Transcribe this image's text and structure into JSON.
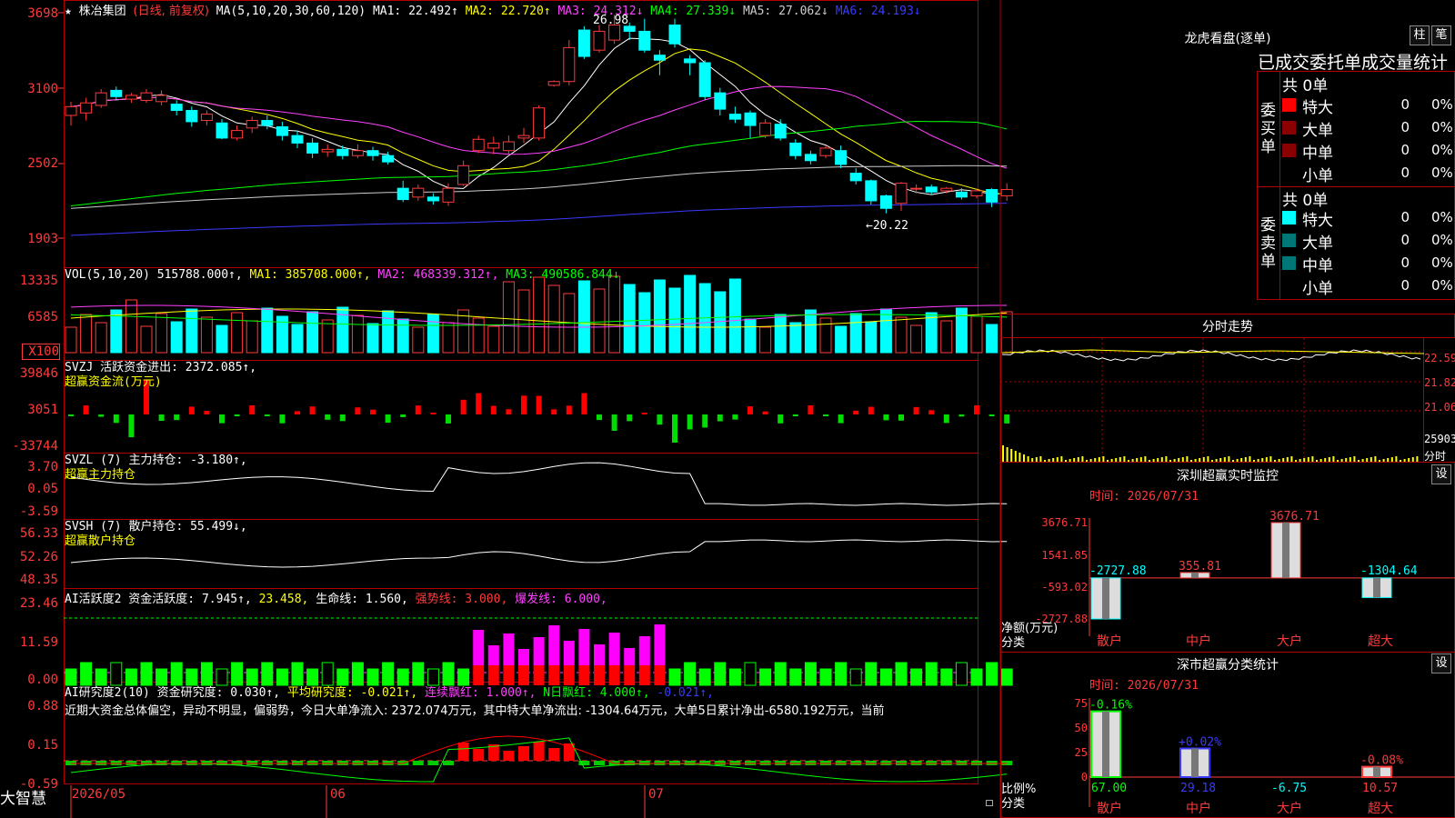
{
  "header": {
    "star": "★",
    "name": "株冶集团",
    "mode": "(日线, 前复权)",
    "ma_def": "MA(5,10,20,30,60,120)",
    "ma": [
      {
        "label": "MA1: 22.492↑",
        "color": "#ffffff"
      },
      {
        "label": "MA2: 22.720↑",
        "color": "#ffff00"
      },
      {
        "label": "MA3: 24.312↓",
        "color": "#ff40ff"
      },
      {
        "label": "MA4: 27.339↓",
        "color": "#00ff00"
      },
      {
        "label": "MA5: 27.062↓",
        "color": "#cccccc"
      },
      {
        "label": "MA6: 24.193↓",
        "color": "#3a3aff"
      }
    ],
    "high_mark": "26.98",
    "low_mark": "←20.22"
  },
  "panes": {
    "price_ticks": [
      "3698",
      "3100",
      "2502",
      "1903"
    ],
    "vol_ticks": [
      "13335",
      "6585",
      "X100"
    ],
    "svzj_ticks": [
      "39846",
      "3051",
      "-33744"
    ],
    "svzl_ticks": [
      "3.70",
      "0.05",
      "-3.59"
    ],
    "svsh_ticks": [
      "56.33",
      "52.26",
      "48.35"
    ],
    "ai_ticks": [
      "23.46",
      "11.59",
      "0.00"
    ],
    "ai2_ticks": [
      "0.88",
      "0.15",
      "-0.59"
    ],
    "vol_header": {
      "def": "VOL(5,10,20)",
      "v": "515788.000↑,",
      "ma1": "MA1: 385708.000↑,",
      "ma2": "MA2: 468339.312↑,",
      "ma3": "MA3: 490586.844↓"
    },
    "svzj_header": {
      "a": "SVZJ  活跃资金进出: 2372.085↑,",
      "b": "超赢资金流(万元)"
    },
    "svzl_header": {
      "a": "SVZL (7) 主力持仓: -3.180↑,",
      "b": "超赢主力持仓"
    },
    "svsh_header": {
      "a": "SVSH (7) 散户持仓: 55.499↓,",
      "b": "超赢散户持仓"
    },
    "ai_header": {
      "a": "AI活跃度2 资金活跃度: 7.945↑,",
      "b": "23.458,",
      "c": "生命线: 1.560,",
      "d": "强势线: 3.000,",
      "e": "爆发线: 6.000,"
    },
    "ai2_header": {
      "a": "AI研究度2(10) 资金研究度: 0.030↑,",
      "b": "平均研究度: -0.021↑,",
      "c": "连续飘红: 1.000↑,",
      "d": "N日飘红: 4.000↑,",
      "e": "-0.021↑,"
    },
    "commentary": "近期大资金总体偏空，异动不明显，偏弱势，今日大单净流入: 2372.074万元，其中特大单净流出: -1304.64万元，大单5日累计净出-6580.192万元，当前"
  },
  "bottom": {
    "brand": "大智慧",
    "dates": [
      "2026/05",
      "06",
      "07"
    ]
  },
  "right": {
    "lhb_title": "龙虎看盘(逐单)",
    "btn_zhu": "柱",
    "btn_bi": "笔",
    "stats_title": "已成交委托单成交量统计",
    "buy_total": "共 0单",
    "sell_total": "共 0单",
    "buy_label": "委买单",
    "sell_label": "委卖单",
    "rows": [
      {
        "name": "特大",
        "val": "0",
        "pct": "0%"
      },
      {
        "name": "大单",
        "val": "0",
        "pct": "0%"
      },
      {
        "name": "中单",
        "val": "0",
        "pct": "0%"
      },
      {
        "name": "小单",
        "val": "0",
        "pct": "0%"
      }
    ],
    "intraday_title": "分时走势",
    "intraday_ticks": [
      "22.59",
      "21.82",
      "21.06",
      "25903",
      "分时"
    ],
    "sz_title": "深圳超赢实时监控",
    "sz_btn": "设",
    "sz_time": "时间: 2026/07/31",
    "sz_ticks": [
      "3676.71",
      "1541.85",
      "-593.02",
      "-2727.88"
    ],
    "sz_axis_name1": "净额(万元)",
    "sz_axis_name2": "分类",
    "cls_title": "深市超赢分类统计",
    "cls_btn": "设",
    "cls_time": "时间: 2026/07/31",
    "cls_ticks": [
      "75",
      "50",
      "25",
      "0"
    ],
    "cls_axis_name1": "比例%",
    "cls_axis_name2": "分类"
  },
  "chart_data": [
    {
      "type": "bar",
      "name": "深圳超赢实时监控",
      "categories": [
        "散户",
        "中户",
        "大户",
        "超大"
      ],
      "values": [
        -2727.88,
        355.81,
        3676.71,
        -1304.64
      ],
      "labels": [
        "-2727.88",
        "355.81",
        "3676.71",
        "-1304.64"
      ],
      "ylim": [
        -2727.88,
        3676.71
      ]
    },
    {
      "type": "bar",
      "name": "深市超赢分类统计",
      "categories": [
        "散户",
        "中户",
        "大户",
        "超大"
      ],
      "values": [
        67.0,
        29.18,
        -6.75,
        10.57
      ],
      "changes": [
        "-0.16%",
        "+0.02%",
        "",
        "-0.08%"
      ],
      "bottom_labels": [
        "67.00",
        "29.18",
        "-6.75",
        "10.57"
      ],
      "ylim": [
        0,
        75
      ]
    },
    {
      "type": "line",
      "name": "price-ma",
      "ylim": [
        1903,
        3698
      ],
      "candles": [
        [
          2880,
          2950,
          2800,
          2990
        ],
        [
          2900,
          2980,
          2840,
          3020
        ],
        [
          2960,
          3060,
          2940,
          3090
        ],
        [
          3080,
          3030,
          3000,
          3110
        ],
        [
          3010,
          3040,
          2980,
          3060
        ],
        [
          3000,
          3060,
          2980,
          3090
        ],
        [
          2990,
          3040,
          2960,
          3080
        ],
        [
          2970,
          2920,
          2880,
          3000
        ],
        [
          2920,
          2830,
          2790,
          2950
        ],
        [
          2840,
          2890,
          2800,
          2920
        ],
        [
          2820,
          2700,
          2690,
          2850
        ],
        [
          2700,
          2760,
          2680,
          2800
        ],
        [
          2780,
          2840,
          2740,
          2870
        ],
        [
          2840,
          2800,
          2770,
          2880
        ],
        [
          2790,
          2720,
          2680,
          2830
        ],
        [
          2720,
          2660,
          2620,
          2760
        ],
        [
          2660,
          2580,
          2540,
          2700
        ],
        [
          2590,
          2610,
          2550,
          2650
        ],
        [
          2610,
          2560,
          2530,
          2640
        ],
        [
          2560,
          2600,
          2540,
          2650
        ],
        [
          2600,
          2560,
          2520,
          2630
        ],
        [
          2560,
          2510,
          2490,
          2590
        ],
        [
          2300,
          2210,
          2190,
          2360
        ],
        [
          2230,
          2300,
          2200,
          2330
        ],
        [
          2230,
          2200,
          2170,
          2260
        ],
        [
          2190,
          2300,
          2160,
          2340
        ],
        [
          2330,
          2480,
          2320,
          2520
        ],
        [
          2600,
          2690,
          2580,
          2720
        ],
        [
          2620,
          2660,
          2570,
          2710
        ],
        [
          2600,
          2670,
          2560,
          2720
        ],
        [
          2700,
          2720,
          2660,
          2780
        ],
        [
          2700,
          2940,
          2680,
          2960
        ],
        [
          3120,
          3150,
          3110,
          3160
        ],
        [
          3150,
          3420,
          3120,
          3480
        ],
        [
          3560,
          3350,
          3330,
          3590
        ],
        [
          3400,
          3550,
          3380,
          3600
        ],
        [
          3480,
          3600,
          3450,
          3680
        ],
        [
          3590,
          3550,
          3480,
          3620
        ],
        [
          3550,
          3400,
          3380,
          3650
        ],
        [
          3360,
          3320,
          3200,
          3400
        ],
        [
          3600,
          3450,
          3420,
          3650
        ],
        [
          3330,
          3300,
          3200,
          3360
        ],
        [
          3300,
          3030,
          3000,
          3320
        ],
        [
          3060,
          2930,
          2880,
          3100
        ],
        [
          2890,
          2850,
          2820,
          2950
        ],
        [
          2900,
          2800,
          2700,
          2920
        ],
        [
          2720,
          2820,
          2700,
          2850
        ],
        [
          2810,
          2700,
          2680,
          2850
        ],
        [
          2660,
          2560,
          2530,
          2690
        ],
        [
          2570,
          2520,
          2490,
          2600
        ],
        [
          2560,
          2620,
          2540,
          2640
        ],
        [
          2600,
          2490,
          2460,
          2640
        ],
        [
          2420,
          2360,
          2330,
          2460
        ],
        [
          2360,
          2200,
          2170,
          2370
        ],
        [
          2240,
          2140,
          2100,
          2250
        ],
        [
          2180,
          2340,
          2120,
          2350
        ],
        [
          2300,
          2300,
          2260,
          2330
        ],
        [
          2310,
          2270,
          2250,
          2330
        ],
        [
          2280,
          2300,
          2260,
          2310
        ],
        [
          2270,
          2230,
          2210,
          2300
        ],
        [
          2240,
          2280,
          2220,
          2300
        ],
        [
          2290,
          2190,
          2150,
          2300
        ],
        [
          2240,
          2290,
          2200,
          2340
        ]
      ]
    }
  ]
}
